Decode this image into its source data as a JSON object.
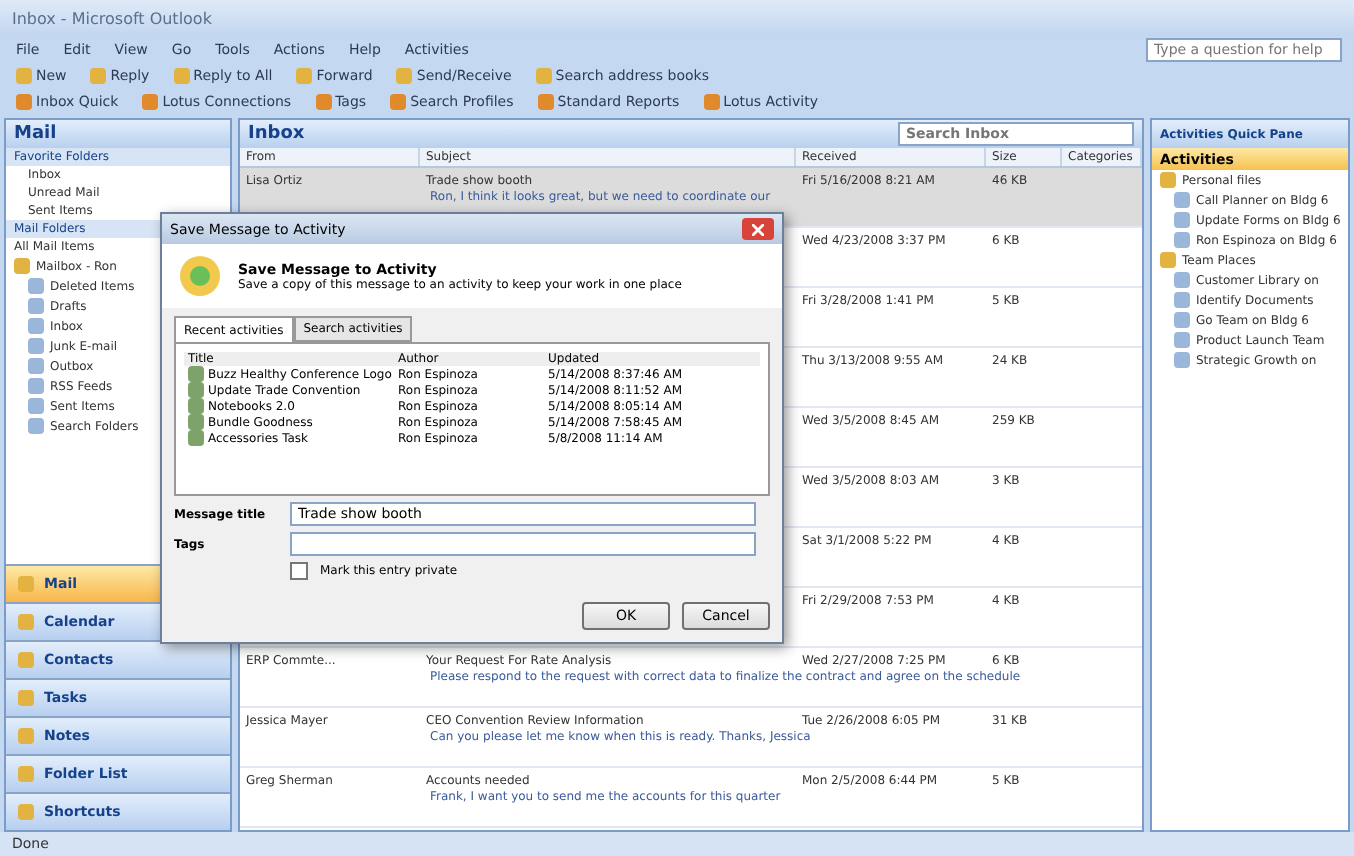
{
  "window": {
    "title": "Inbox - Microsoft Outlook"
  },
  "menu": [
    "File",
    "Edit",
    "View",
    "Go",
    "Tools",
    "Actions",
    "Help",
    "Activities"
  ],
  "search_help": {
    "placeholder": "Type a question for help"
  },
  "toolbar": [
    "New",
    "Reply",
    "Reply to All",
    "Forward",
    "Send/Receive",
    "Search address books"
  ],
  "toolbar2": [
    "Inbox Quick",
    "Lotus Connections",
    "Tags",
    "Search Profiles",
    "Standard Reports",
    "Lotus Activity"
  ],
  "nav": {
    "title": "Mail",
    "favorites_title": "Favorite Folders",
    "favorites": [
      "Inbox",
      "Unread Mail",
      "Sent Items"
    ],
    "folders_title": "Mail Folders",
    "all_items": "All Mail Items",
    "tree": [
      {
        "label": "Mailbox - Ron",
        "children": [
          {
            "label": "Deleted Items"
          },
          {
            "label": "Drafts"
          },
          {
            "label": "Inbox"
          },
          {
            "label": "Junk E-mail"
          },
          {
            "label": "Outbox"
          },
          {
            "label": "RSS Feeds"
          },
          {
            "label": "Sent Items"
          },
          {
            "label": "Search Folders"
          }
        ]
      }
    ],
    "buttons": [
      {
        "label": "Mail",
        "selected": true
      },
      {
        "label": "Calendar",
        "selected": false
      },
      {
        "label": "Contacts",
        "selected": false
      },
      {
        "label": "Tasks",
        "selected": false
      },
      {
        "label": "Notes",
        "selected": false
      },
      {
        "label": "Folder List",
        "selected": false
      },
      {
        "label": "Shortcuts",
        "selected": false
      }
    ]
  },
  "inbox": {
    "title": "Inbox",
    "search": {
      "placeholder": "Search Inbox"
    },
    "columns": [
      "From",
      "Subject",
      "Received",
      "Size",
      "Categories"
    ],
    "messages": [
      {
        "from": "Lisa Ortiz",
        "subject": "Trade show booth",
        "received": "Fri 5/16/2008 8:21 AM",
        "size": "46 KB",
        "preview": "Ron, I think it looks great, but we need to coordinate our",
        "selected": true
      },
      {
        "received": "Wed 4/23/2008 3:37 PM",
        "size": "6 KB",
        "selected": false
      },
      {
        "received": "Fri 3/28/2008 1:41 PM",
        "size": "5 KB",
        "selected": false
      },
      {
        "received": "Thu 3/13/2008 9:55 AM",
        "size": "24 KB",
        "selected": false
      },
      {
        "received": "Wed 3/5/2008 8:45 AM",
        "size": "259 KB",
        "selected": false
      },
      {
        "received": "Wed 3/5/2008 8:03 AM",
        "size": "3 KB",
        "selected": false
      },
      {
        "received": "Sat 3/1/2008 5:22 PM",
        "size": "4 KB",
        "selected": false
      },
      {
        "received": "Fri 2/29/2008 7:53 PM",
        "size": "4 KB",
        "selected": false
      },
      {
        "from": "ERP Commte...",
        "subject": "Your Request For Rate Analysis",
        "received": "Wed 2/27/2008 7:25 PM",
        "size": "6 KB",
        "preview": "Please respond to the request with correct data to finalize the contract and agree on the schedule",
        "selected": false
      },
      {
        "from": "Jessica Mayer",
        "subject": "CEO Convention Review Information",
        "received": "Tue 2/26/2008 6:05 PM",
        "size": "31 KB",
        "preview": "Can you please let me know when this is ready. Thanks, Jessica",
        "selected": false
      },
      {
        "from": "Greg Sherman",
        "subject": "Accounts needed",
        "received": "Mon 2/5/2008 6:44 PM",
        "size": "5 KB",
        "preview": "Frank, I want you to send me the accounts for this quarter",
        "selected": false
      }
    ]
  },
  "todo": {
    "title": "Activities Quick Pane",
    "header": "Activities",
    "tree": [
      {
        "label": "Personal files",
        "children": [
          {
            "label": "Call Planner on Bldg 6"
          },
          {
            "label": "Update Forms on Bldg 6"
          },
          {
            "label": "Ron Espinoza on Bldg 6"
          }
        ]
      },
      {
        "label": "Team Places",
        "children": [
          {
            "label": "Customer Library on"
          },
          {
            "label": "Identify Documents"
          },
          {
            "label": "Go Team on Bldg 6"
          },
          {
            "label": "Product Launch Team"
          },
          {
            "label": "Strategic Growth on"
          }
        ]
      }
    ]
  },
  "dialog": {
    "title": "Save Message to Activity",
    "heading": "Save Message to Activity",
    "description": "Save a copy of this message to an activity to keep your work in one place",
    "tabs": [
      {
        "label": "Recent activities",
        "selected": true
      },
      {
        "label": "Search activities",
        "selected": false
      }
    ],
    "columns": [
      "Title",
      "Author",
      "Updated"
    ],
    "rows": [
      {
        "title": "Buzz Healthy Conference Logo",
        "author": "Ron Espinoza",
        "updated": "5/14/2008 8:37:46 AM"
      },
      {
        "title": "Update Trade Convention",
        "author": "Ron Espinoza",
        "updated": "5/14/2008 8:11:52 AM"
      },
      {
        "title": "Notebooks 2.0",
        "author": "Ron Espinoza",
        "updated": "5/14/2008 8:05:14 AM"
      },
      {
        "title": "Bundle Goodness",
        "author": "Ron Espinoza",
        "updated": "5/14/2008 7:58:45 AM"
      },
      {
        "title": "Accessories Task",
        "author": "Ron Espinoza",
        "updated": "5/8/2008 11:14 AM"
      }
    ],
    "message_title_label": "Message title",
    "message_title": "Trade show booth",
    "tags_label": "Tags",
    "private": {
      "label": "Mark this entry private",
      "checked": false
    },
    "buttons": [
      "OK",
      "Cancel"
    ]
  },
  "status_bar": "Done"
}
